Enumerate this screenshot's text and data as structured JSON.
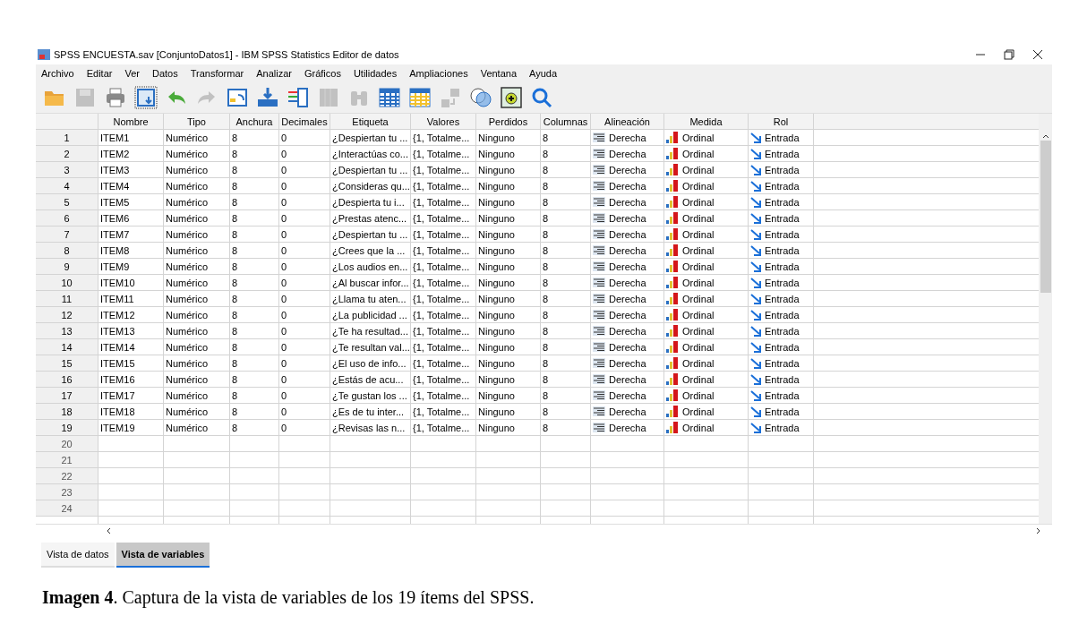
{
  "window": {
    "title": "SPSS ENCUESTA.sav [ConjuntoDatos1] - IBM SPSS Statistics Editor de datos"
  },
  "menu": [
    "Archivo",
    "Editar",
    "Ver",
    "Datos",
    "Transformar",
    "Analizar",
    "Gráficos",
    "Utilidades",
    "Ampliaciones",
    "Ventana",
    "Ayuda"
  ],
  "toolbar": [
    {
      "kind": "open",
      "disabled": false
    },
    {
      "kind": "save",
      "disabled": true
    },
    {
      "kind": "print",
      "disabled": false
    },
    {
      "kind": "recall",
      "disabled": false
    },
    {
      "kind": "undo",
      "disabled": false
    },
    {
      "kind": "redo",
      "disabled": true
    },
    {
      "kind": "goto",
      "disabled": false
    },
    {
      "kind": "import",
      "disabled": false
    },
    {
      "kind": "list",
      "disabled": false
    },
    {
      "kind": "mu",
      "disabled": true
    },
    {
      "kind": "find",
      "disabled": true
    },
    {
      "kind": "grid",
      "disabled": false
    },
    {
      "kind": "gridy",
      "disabled": false
    },
    {
      "kind": "labels",
      "disabled": true
    },
    {
      "kind": "circles",
      "disabled": false
    },
    {
      "kind": "select",
      "disabled": false
    },
    {
      "kind": "search",
      "disabled": false
    }
  ],
  "table": {
    "columns": [
      "Nombre",
      "Tipo",
      "Anchura",
      "Decimales",
      "Etiqueta",
      "Valores",
      "Perdidos",
      "Columnas",
      "Alineación",
      "Medida",
      "Rol"
    ],
    "rows": [
      {
        "n": "1",
        "cells": [
          "ITEM1",
          "Numérico",
          "8",
          "0",
          "¿Despiertan tu ...",
          "{1, Totalme...",
          "Ninguno",
          "8",
          "Derecha",
          "Ordinal",
          "Entrada"
        ]
      },
      {
        "n": "2",
        "cells": [
          "ITEM2",
          "Numérico",
          "8",
          "0",
          "¿Interactúas co...",
          "{1, Totalme...",
          "Ninguno",
          "8",
          "Derecha",
          "Ordinal",
          "Entrada"
        ]
      },
      {
        "n": "3",
        "cells": [
          "ITEM3",
          "Numérico",
          "8",
          "0",
          "¿Despiertan tu ...",
          "{1, Totalme...",
          "Ninguno",
          "8",
          "Derecha",
          "Ordinal",
          "Entrada"
        ]
      },
      {
        "n": "4",
        "cells": [
          "ITEM4",
          "Numérico",
          "8",
          "0",
          "¿Consideras qu...",
          "{1, Totalme...",
          "Ninguno",
          "8",
          "Derecha",
          "Ordinal",
          "Entrada"
        ]
      },
      {
        "n": "5",
        "cells": [
          "ITEM5",
          "Numérico",
          "8",
          "0",
          "¿Despierta tu i...",
          "{1, Totalme...",
          "Ninguno",
          "8",
          "Derecha",
          "Ordinal",
          "Entrada"
        ]
      },
      {
        "n": "6",
        "cells": [
          "ITEM6",
          "Numérico",
          "8",
          "0",
          "¿Prestas atenc...",
          "{1, Totalme...",
          "Ninguno",
          "8",
          "Derecha",
          "Ordinal",
          "Entrada"
        ]
      },
      {
        "n": "7",
        "cells": [
          "ITEM7",
          "Numérico",
          "8",
          "0",
          "¿Despiertan tu ...",
          "{1, Totalme...",
          "Ninguno",
          "8",
          "Derecha",
          "Ordinal",
          "Entrada"
        ]
      },
      {
        "n": "8",
        "cells": [
          "ITEM8",
          "Numérico",
          "8",
          "0",
          "¿Crees que la ...",
          "{1, Totalme...",
          "Ninguno",
          "8",
          "Derecha",
          "Ordinal",
          "Entrada"
        ]
      },
      {
        "n": "9",
        "cells": [
          "ITEM9",
          "Numérico",
          "8",
          "0",
          "¿Los audios en...",
          "{1, Totalme...",
          "Ninguno",
          "8",
          "Derecha",
          "Ordinal",
          "Entrada"
        ]
      },
      {
        "n": "10",
        "cells": [
          "ITEM10",
          "Numérico",
          "8",
          "0",
          "¿Al buscar infor...",
          "{1, Totalme...",
          "Ninguno",
          "8",
          "Derecha",
          "Ordinal",
          "Entrada"
        ]
      },
      {
        "n": "11",
        "cells": [
          "ITEM11",
          "Numérico",
          "8",
          "0",
          "¿Llama tu aten...",
          "{1, Totalme...",
          "Ninguno",
          "8",
          "Derecha",
          "Ordinal",
          "Entrada"
        ]
      },
      {
        "n": "12",
        "cells": [
          "ITEM12",
          "Numérico",
          "8",
          "0",
          "¿La publicidad ...",
          "{1, Totalme...",
          "Ninguno",
          "8",
          "Derecha",
          "Ordinal",
          "Entrada"
        ]
      },
      {
        "n": "13",
        "cells": [
          "ITEM13",
          "Numérico",
          "8",
          "0",
          "¿Te ha resultad...",
          "{1, Totalme...",
          "Ninguno",
          "8",
          "Derecha",
          "Ordinal",
          "Entrada"
        ]
      },
      {
        "n": "14",
        "cells": [
          "ITEM14",
          "Numérico",
          "8",
          "0",
          "¿Te resultan val...",
          "{1, Totalme...",
          "Ninguno",
          "8",
          "Derecha",
          "Ordinal",
          "Entrada"
        ]
      },
      {
        "n": "15",
        "cells": [
          "ITEM15",
          "Numérico",
          "8",
          "0",
          "¿El uso de info...",
          "{1, Totalme...",
          "Ninguno",
          "8",
          "Derecha",
          "Ordinal",
          "Entrada"
        ]
      },
      {
        "n": "16",
        "cells": [
          "ITEM16",
          "Numérico",
          "8",
          "0",
          "¿Estás de acu...",
          "{1, Totalme...",
          "Ninguno",
          "8",
          "Derecha",
          "Ordinal",
          "Entrada"
        ]
      },
      {
        "n": "17",
        "cells": [
          "ITEM17",
          "Numérico",
          "8",
          "0",
          "¿Te gustan los ...",
          "{1, Totalme...",
          "Ninguno",
          "8",
          "Derecha",
          "Ordinal",
          "Entrada"
        ]
      },
      {
        "n": "18",
        "cells": [
          "ITEM18",
          "Numérico",
          "8",
          "0",
          "¿Es de tu inter...",
          "{1, Totalme...",
          "Ninguno",
          "8",
          "Derecha",
          "Ordinal",
          "Entrada"
        ]
      },
      {
        "n": "19",
        "cells": [
          "ITEM19",
          "Numérico",
          "8",
          "0",
          "¿Revisas las n...",
          "{1, Totalme...",
          "Ninguno",
          "8",
          "Derecha",
          "Ordinal",
          "Entrada"
        ]
      },
      {
        "n": "20"
      },
      {
        "n": "21"
      },
      {
        "n": "22"
      },
      {
        "n": "23"
      },
      {
        "n": "24"
      }
    ]
  },
  "tabs": [
    {
      "label": "Vista de datos",
      "selected": false
    },
    {
      "label": "Vista de variables",
      "selected": true
    }
  ],
  "caption": "**Imagen 4**. Captura de la vista de variables de los 19 ítems del SPSS."
}
